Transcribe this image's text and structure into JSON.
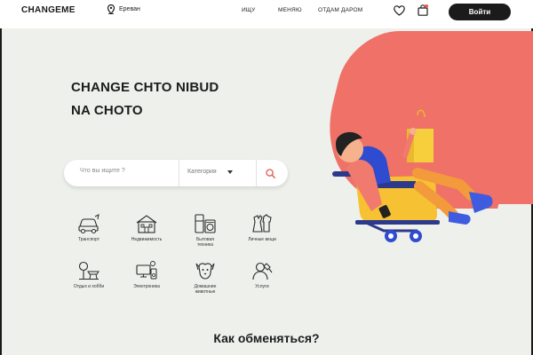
{
  "header": {
    "logo": "CHANGEME",
    "location": "Ереван",
    "nav": [
      "ИЩУ",
      "МЕНЯЮ",
      "ОТДАМ ДАРОМ"
    ],
    "login_label": "Войти"
  },
  "hero": {
    "title_line1": "CHANGE CHTO NIBUD",
    "title_line2": "NA CHOTO"
  },
  "search": {
    "placeholder": "Что вы ищите ?",
    "category_label": "Категория"
  },
  "categories": [
    {
      "label": "Транспорт",
      "icon": "car-icon"
    },
    {
      "label": "Недвижимость",
      "icon": "house-icon"
    },
    {
      "label": "Бытовая\nтехника",
      "icon": "appliances-icon"
    },
    {
      "label": "Личные вещи",
      "icon": "clothes-icon"
    },
    {
      "label": "Отдых и хобби",
      "icon": "hobby-icon"
    },
    {
      "label": "Электроника",
      "icon": "electronics-icon"
    },
    {
      "label": "Домашние\nживотные",
      "icon": "pets-icon"
    },
    {
      "label": "Услуги",
      "icon": "services-icon"
    }
  ],
  "section_title": "Как обменяться?",
  "colors": {
    "accent": "#ef7167",
    "background": "#eef0ec",
    "button": "#1b1b1b",
    "search_icon": "#e2584e"
  }
}
